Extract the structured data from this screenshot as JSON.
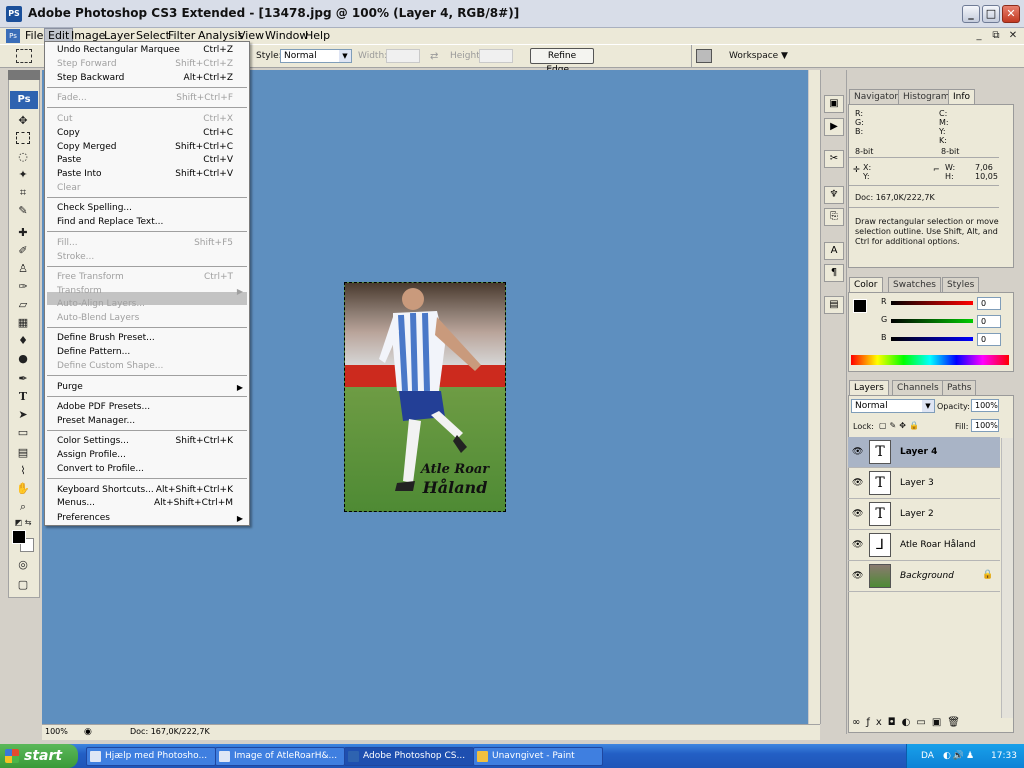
{
  "window": {
    "app_icon": "PS",
    "title": "Adobe Photoshop CS3 Extended - [13478.jpg @ 100% (Layer 4, RGB/8#)]",
    "buttons": {
      "minimize": "_",
      "maximize": "□",
      "close": "✕"
    }
  },
  "menubar": {
    "items": [
      "File",
      "Edit",
      "Image",
      "Layer",
      "Select",
      "Filter",
      "Analysis",
      "View",
      "Window",
      "Help"
    ],
    "active": "Edit",
    "doc_buttons": [
      "_",
      "⧉",
      "✕"
    ]
  },
  "options": {
    "style_label": "Style:",
    "style_value": "Normal",
    "width_label": "Width:",
    "height_label": "Height:",
    "swap_icon": "swap-arrows-icon",
    "refine_edge": "Refine Edge...",
    "workspace": "Workspace ▼"
  },
  "edit_menu": [
    {
      "label": "Undo Rectangular Marquee",
      "shortcut": "Ctrl+Z",
      "enabled": true
    },
    {
      "label": "Step Forward",
      "shortcut": "Shift+Ctrl+Z",
      "enabled": false
    },
    {
      "label": "Step Backward",
      "shortcut": "Alt+Ctrl+Z",
      "enabled": true
    },
    {
      "label": "Fade...",
      "shortcut": "Shift+Ctrl+F",
      "enabled": false
    },
    {
      "label": "Cut",
      "shortcut": "Ctrl+X",
      "enabled": false
    },
    {
      "label": "Copy",
      "shortcut": "Ctrl+C",
      "enabled": true
    },
    {
      "label": "Copy Merged",
      "shortcut": "Shift+Ctrl+C",
      "enabled": true
    },
    {
      "label": "Paste",
      "shortcut": "Ctrl+V",
      "enabled": true
    },
    {
      "label": "Paste Into",
      "shortcut": "Shift+Ctrl+V",
      "enabled": true
    },
    {
      "label": "Clear",
      "shortcut": "",
      "enabled": false
    },
    {
      "label": "Check Spelling...",
      "shortcut": "",
      "enabled": true
    },
    {
      "label": "Find and Replace Text...",
      "shortcut": "",
      "enabled": true
    },
    {
      "label": "Fill...",
      "shortcut": "Shift+F5",
      "enabled": false
    },
    {
      "label": "Stroke...",
      "shortcut": "",
      "enabled": false
    },
    {
      "label": "Free Transform",
      "shortcut": "Ctrl+T",
      "enabled": false
    },
    {
      "label": "Transform",
      "shortcut": "",
      "enabled": false
    },
    {
      "label": "Auto-Align Layers...",
      "shortcut": "",
      "enabled": false
    },
    {
      "label": "Auto-Blend Layers",
      "shortcut": "",
      "enabled": false
    },
    {
      "label": "Define Brush Preset...",
      "shortcut": "",
      "enabled": true
    },
    {
      "label": "Define Pattern...",
      "shortcut": "",
      "enabled": true
    },
    {
      "label": "Define Custom Shape...",
      "shortcut": "",
      "enabled": false
    },
    {
      "label": "Purge",
      "shortcut": "",
      "enabled": true
    },
    {
      "label": "Adobe PDF Presets...",
      "shortcut": "",
      "enabled": true
    },
    {
      "label": "Preset Manager...",
      "shortcut": "",
      "enabled": true
    },
    {
      "label": "Color Settings...",
      "shortcut": "Shift+Ctrl+K",
      "enabled": true
    },
    {
      "label": "Assign Profile...",
      "shortcut": "",
      "enabled": true
    },
    {
      "label": "Convert to Profile...",
      "shortcut": "",
      "enabled": true
    },
    {
      "label": "Keyboard Shortcuts...",
      "shortcut": "Alt+Shift+Ctrl+K",
      "enabled": true
    },
    {
      "label": "Menus...",
      "shortcut": "Alt+Shift+Ctrl+M",
      "enabled": true
    },
    {
      "label": "Preferences",
      "shortcut": "",
      "enabled": true
    }
  ],
  "image": {
    "caption_line1": "Atle Roar",
    "caption_line2": "Håland"
  },
  "info_panel": {
    "tabs": [
      "Navigator",
      "Histogram",
      "Info"
    ],
    "active_tab": "Info",
    "rgb_labels": "R:\nG:\nB:",
    "cmyk_labels": "C:\nM:\nY:\nK:",
    "bit_left": "8-bit",
    "bit_right": "8-bit",
    "xy": "X:\nY:",
    "w": "W:",
    "h": "H:",
    "w_val": "7,06",
    "h_val": "10,05",
    "doc": "Doc: 167,0K/222,7K",
    "hint": "Draw rectangular selection or move selection outline.  Use Shift, Alt, and Ctrl for additional options."
  },
  "color_panel": {
    "tabs": [
      "Color",
      "Swatches",
      "Styles"
    ],
    "active_tab": "Color",
    "r": "0",
    "g": "0",
    "b": "0",
    "r_label": "R",
    "g_label": "G",
    "b_label": "B"
  },
  "layers_panel": {
    "tabs": [
      "Layers",
      "Channels",
      "Paths"
    ],
    "active_tab": "Layers",
    "blend": "Normal",
    "opacity_label": "Opacity:",
    "opacity": "100%",
    "lock_label": "Lock:",
    "fill_label": "Fill:",
    "fill": "100%",
    "layers": [
      {
        "name": "Layer 4",
        "thumb": "T",
        "active": true
      },
      {
        "name": "Layer 3",
        "thumb": "T",
        "active": false
      },
      {
        "name": "Layer 2",
        "thumb": "T",
        "active": false
      },
      {
        "name": "Atle Roar Håland",
        "thumb": "⅃",
        "active": false
      },
      {
        "name": "Background",
        "thumb": "",
        "active": false
      }
    ]
  },
  "status": {
    "zoom": "100%",
    "doc": "Doc: 167,0K/222,7K"
  },
  "taskbar": {
    "start": "start",
    "items": [
      {
        "label": "Hjælp med Photosho...",
        "active": false
      },
      {
        "label": "Image of AtleRoarH&...",
        "active": false
      },
      {
        "label": "Adobe Photoshop CS...",
        "active": true
      },
      {
        "label": "Unavngivet - Paint",
        "active": false
      }
    ],
    "lang": "DA",
    "clock": "17:33"
  },
  "colors": {
    "canvas": "#5e8fbf",
    "taskbar": "#235fc5",
    "start": "#3a9a38",
    "accent": "#2e63b0"
  }
}
